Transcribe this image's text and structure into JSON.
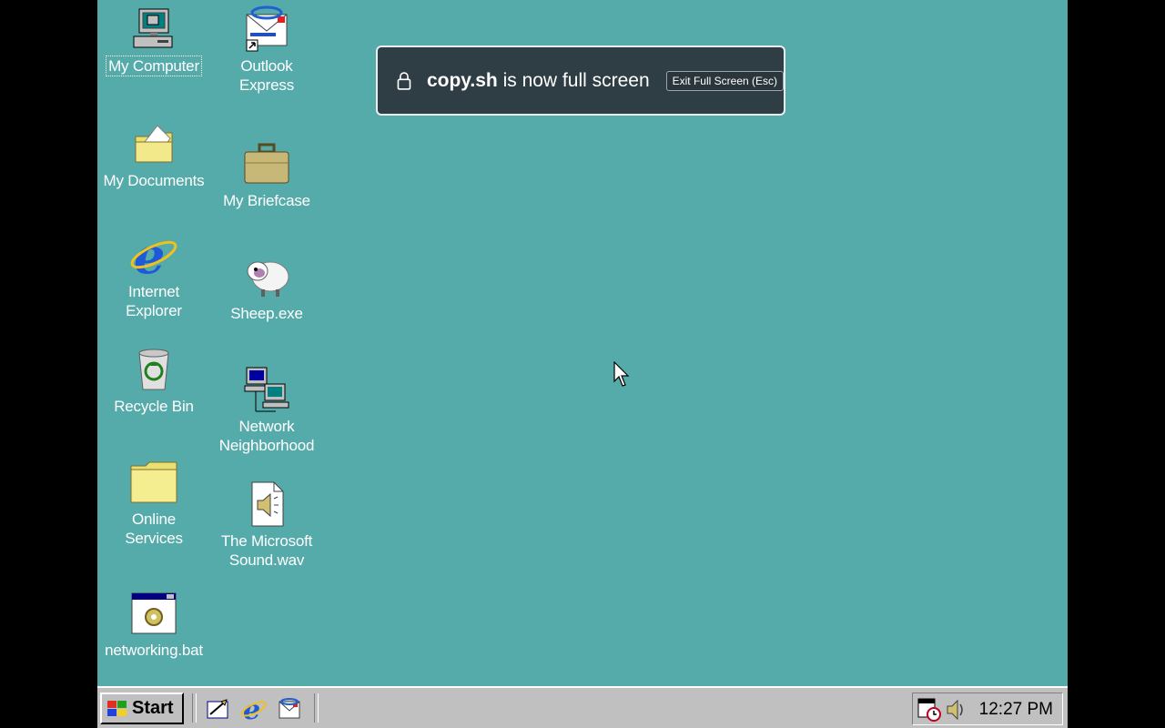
{
  "desktop": {
    "icons": [
      {
        "label": "My Computer",
        "icon": "my-computer-icon"
      },
      {
        "label": "Outlook\nExpress",
        "icon": "outlook-express-icon"
      },
      {
        "label": "My Documents",
        "icon": "my-documents-icon"
      },
      {
        "label": "My Briefcase",
        "icon": "briefcase-icon"
      },
      {
        "label": "Internet\nExplorer",
        "icon": "internet-explorer-icon"
      },
      {
        "label": "Sheep.exe",
        "icon": "sheep-icon"
      },
      {
        "label": "Recycle Bin",
        "icon": "recycle-bin-icon"
      },
      {
        "label": "Network\nNeighborhood",
        "icon": "network-neighborhood-icon"
      },
      {
        "label": "Online\nServices",
        "icon": "folder-icon"
      },
      {
        "label": "The Microsoft\nSound.wav",
        "icon": "sound-file-icon"
      },
      {
        "label": "networking.bat",
        "icon": "batch-file-icon"
      }
    ],
    "background_color": "#55aaaa"
  },
  "toast": {
    "site": "copy.sh",
    "message": " is now full screen",
    "exit_label": "Exit Full Screen (Esc)"
  },
  "taskbar": {
    "start_label": "Start",
    "quick_launch": [
      "show-desktop-icon",
      "internet-explorer-icon",
      "outlook-express-icon"
    ],
    "tray_icons": [
      "scheduler-icon",
      "volume-icon"
    ],
    "clock": "12:27 PM"
  }
}
